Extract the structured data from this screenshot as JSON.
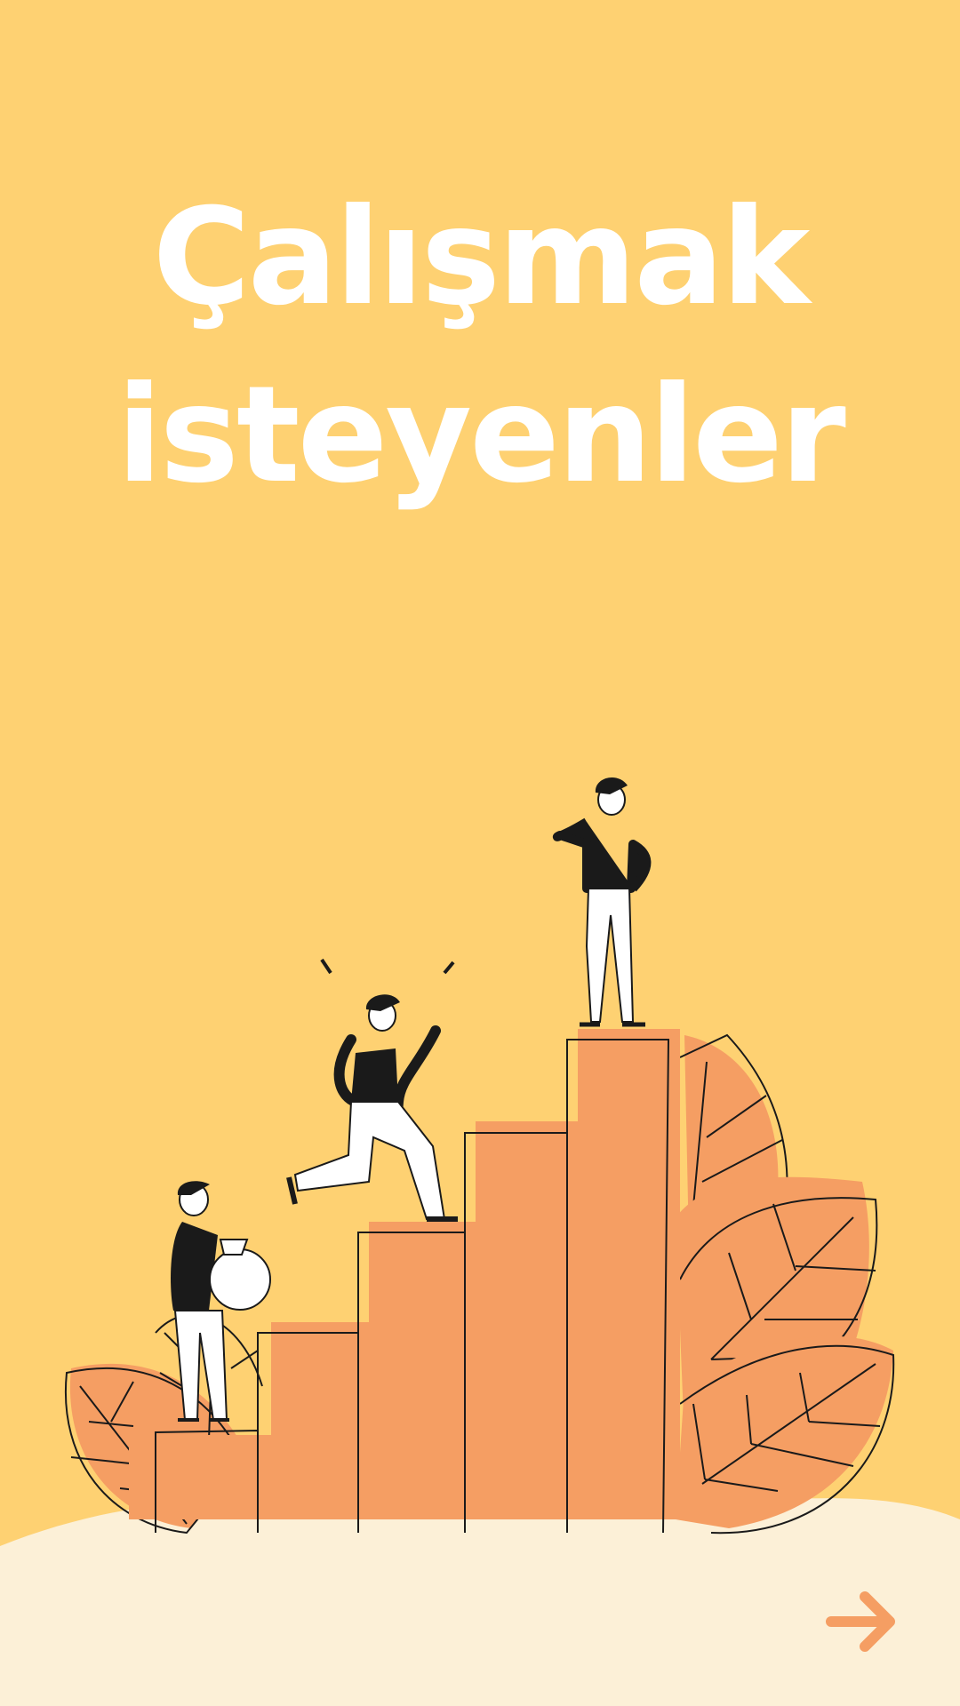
{
  "title": {
    "line1": "Çalışmak",
    "line2": "isteyenler"
  },
  "colors": {
    "background": "#FED172",
    "ground": "#FCF0D7",
    "accent": "#F59E63",
    "ink": "#1A1A1A",
    "title": "#FFFFFF"
  },
  "illustration": {
    "name": "people-climbing-stairs",
    "figures": [
      "person-carrying-sack",
      "person-jumping",
      "person-looking-ahead"
    ]
  },
  "navigation": {
    "next_icon": "arrow-right-icon"
  }
}
